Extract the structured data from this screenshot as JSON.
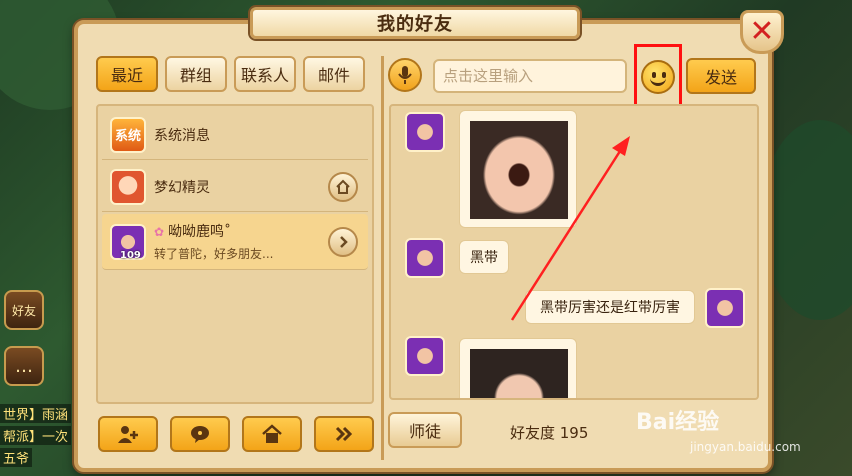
{
  "title": "我的好友",
  "close_glyph": "✕",
  "tabs": [
    {
      "label": "最近",
      "active": true
    },
    {
      "label": "群组",
      "active": false
    },
    {
      "label": "联系人",
      "active": false
    },
    {
      "label": "邮件",
      "active": false
    }
  ],
  "contacts": [
    {
      "avatar_text": "系统",
      "name": "系统消息",
      "sub": "",
      "button_icon": ""
    },
    {
      "avatar_text": "",
      "name": "梦幻精灵",
      "sub": "",
      "button_icon": "house-icon"
    },
    {
      "avatar_text": "",
      "level": "109",
      "name": "呦呦鹿鸣˚",
      "sub": "转了普陀，好多朋友...",
      "button_icon": "chevron-right-icon"
    }
  ],
  "bottom_buttons": [
    "add-friend-icon",
    "chat-bubble-icon",
    "house-icon",
    "double-chevron-icon"
  ],
  "input": {
    "placeholder": "点击这里输入"
  },
  "send_label": "发送",
  "messages": [
    {
      "side": "left",
      "type": "image"
    },
    {
      "side": "left",
      "type": "text",
      "text": "黑带"
    },
    {
      "side": "right",
      "type": "text",
      "text": "黑带厉害还是红带厉害"
    },
    {
      "side": "left",
      "type": "image"
    }
  ],
  "mentor_label": "师徒",
  "intimacy": "好友度 195",
  "hud": {
    "friends_label": "好友",
    "chat_lines": [
      "世界】雨涵",
      "帮派】一次",
      "五爷"
    ]
  },
  "watermark": {
    "brand": "Bai经验",
    "url": "jingyan.baidu.com"
  },
  "colors": {
    "accent": "#f3a418",
    "panel": "#f0dcb2",
    "highlight": "#ff1010"
  }
}
